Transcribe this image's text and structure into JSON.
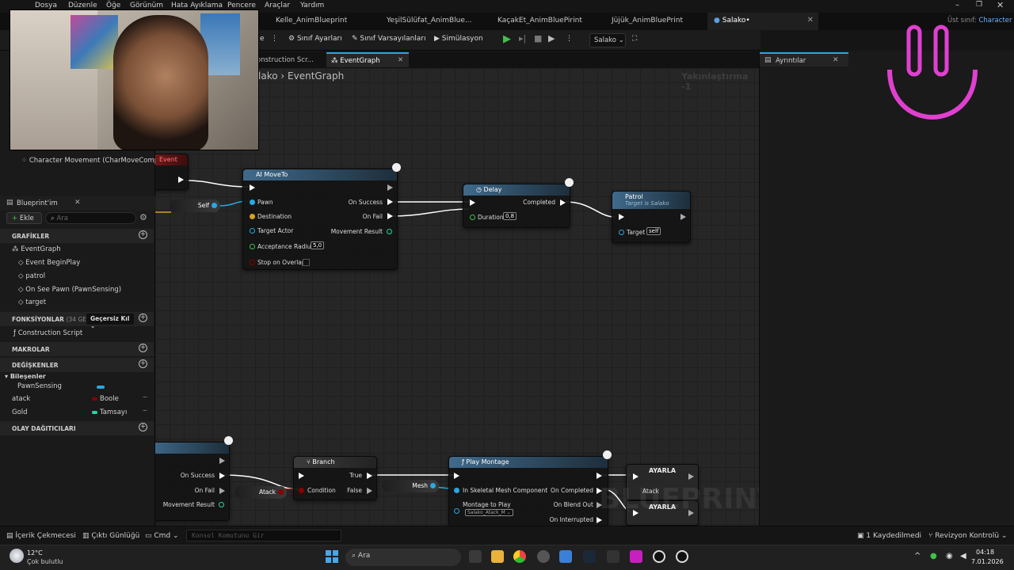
{
  "menu": [
    "Dosya",
    "Düzenle",
    "Öğe",
    "Görünüm",
    "Hata Ayıklama",
    "Pencere",
    "Araçlar",
    "Yardım"
  ],
  "doc_tabs": [
    {
      "label": "Kelle_AnimBlueprint"
    },
    {
      "label": "YeşilSülüfat_AnimBlue..."
    },
    {
      "label": "KaçakEt_AnimBluePirint"
    },
    {
      "label": "Jüjük_AnimBluePrint"
    },
    {
      "label": "Salako•"
    }
  ],
  "parent_class": {
    "label": "Üst sınıf:",
    "value": "Character"
  },
  "toolbar": {
    "class_settings": "Sınıf Ayarları",
    "class_defaults": "Sınıf Varsayılanları",
    "simulation": "Simülasyon",
    "debug_target": "Salako"
  },
  "graph_tabs": [
    {
      "label": "onstruction Scr..."
    },
    {
      "label": "EventGraph"
    }
  ],
  "breadcrumb": {
    "root": "lako",
    "current": "EventGraph"
  },
  "zoom_label": "Yakınlaştırma -1",
  "components_item": "Character Movement (CharMoveComp)",
  "my_blueprint": {
    "title": "Blueprint'im",
    "add_label": "Ekle",
    "search_placeholder": "Ara",
    "sections": {
      "graphs": "GRAFİKLER",
      "functions": "FONKSİYONLAR",
      "functions_count": "(34 GEÇERS",
      "override_label": "Geçersiz Kıl",
      "macros": "MAKROLAR",
      "variables": "DEĞİŞKENLER",
      "dispatchers": "OLAY DAĞITICILARI"
    },
    "graph_items": [
      "EventGraph",
      "Event BeginPlay",
      "patrol",
      "On See Pawn (PawnSensing)",
      "target"
    ],
    "function_items": [
      "Construction Script"
    ],
    "components_group": "Bileşenler",
    "variables": [
      {
        "name": "PawnSensing",
        "type": "",
        "color": "#2aa7e0"
      },
      {
        "name": "atack",
        "type": "Boole",
        "color": "#8a0000"
      },
      {
        "name": "Gold",
        "type": "Tamsayı",
        "color": "#1ed9a3"
      }
    ]
  },
  "details": {
    "title": "Ayrıntılar"
  },
  "nodes": {
    "event_partial": "Event",
    "self_var": "Self",
    "ai_moveto": {
      "title": "AI MoveTo",
      "inputs": [
        "Pawn",
        "Destination",
        "Target Actor",
        "Acceptance Radius",
        "Stop on Overlap"
      ],
      "acceptance_radius": "5,0",
      "outputs": [
        "On Success",
        "On Fail",
        "Movement Result"
      ]
    },
    "delay": {
      "title": "Delay",
      "duration_label": "Duration",
      "duration": "0,8",
      "completed": "Completed"
    },
    "patrol": {
      "title": "Patrol",
      "subtitle": "Target is Salako",
      "target_label": "Target",
      "target_value": "self"
    },
    "lower_partial": {
      "outputs": [
        "On Success",
        "On Fail",
        "Movement Result"
      ]
    },
    "atack_var": "Atack",
    "branch": {
      "title": "Branch",
      "condition": "Condition",
      "true": "True",
      "false": "False"
    },
    "mesh_var": "Mesh",
    "play_montage": {
      "title": "Play Montage",
      "skel": "In Skeletal Mesh Component",
      "montage_label": "Montage to Play",
      "montage_value": "Salako_Atack_M",
      "outputs": [
        "On Completed",
        "On Blend Out",
        "On Interrupted"
      ]
    },
    "set1": {
      "title": "AYARLA",
      "pin": "Atack"
    },
    "set2": {
      "title": "AYARLA"
    }
  },
  "watermark": "BLUEPRINT",
  "bottom_bar": {
    "content_drawer": "İçerik Çekmecesi",
    "output_log": "Çıktı Günlüğü",
    "cmd": "Cmd",
    "console_placeholder": "Konsol Komutunu Gir",
    "unsaved": "1 Kaydedilmedi",
    "revision": "Revizyon Kontrolü"
  },
  "taskbar": {
    "weather_temp": "12°C",
    "weather_desc": "Çok bulutlu",
    "search": "Ara",
    "time": "04:18",
    "date": "7.01.2026"
  },
  "colors": {
    "accent": "#2aa7e0",
    "exec": "#ffffff",
    "bool": "#8a0000",
    "int": "#1ed9a3",
    "object": "#2aa7e0"
  }
}
